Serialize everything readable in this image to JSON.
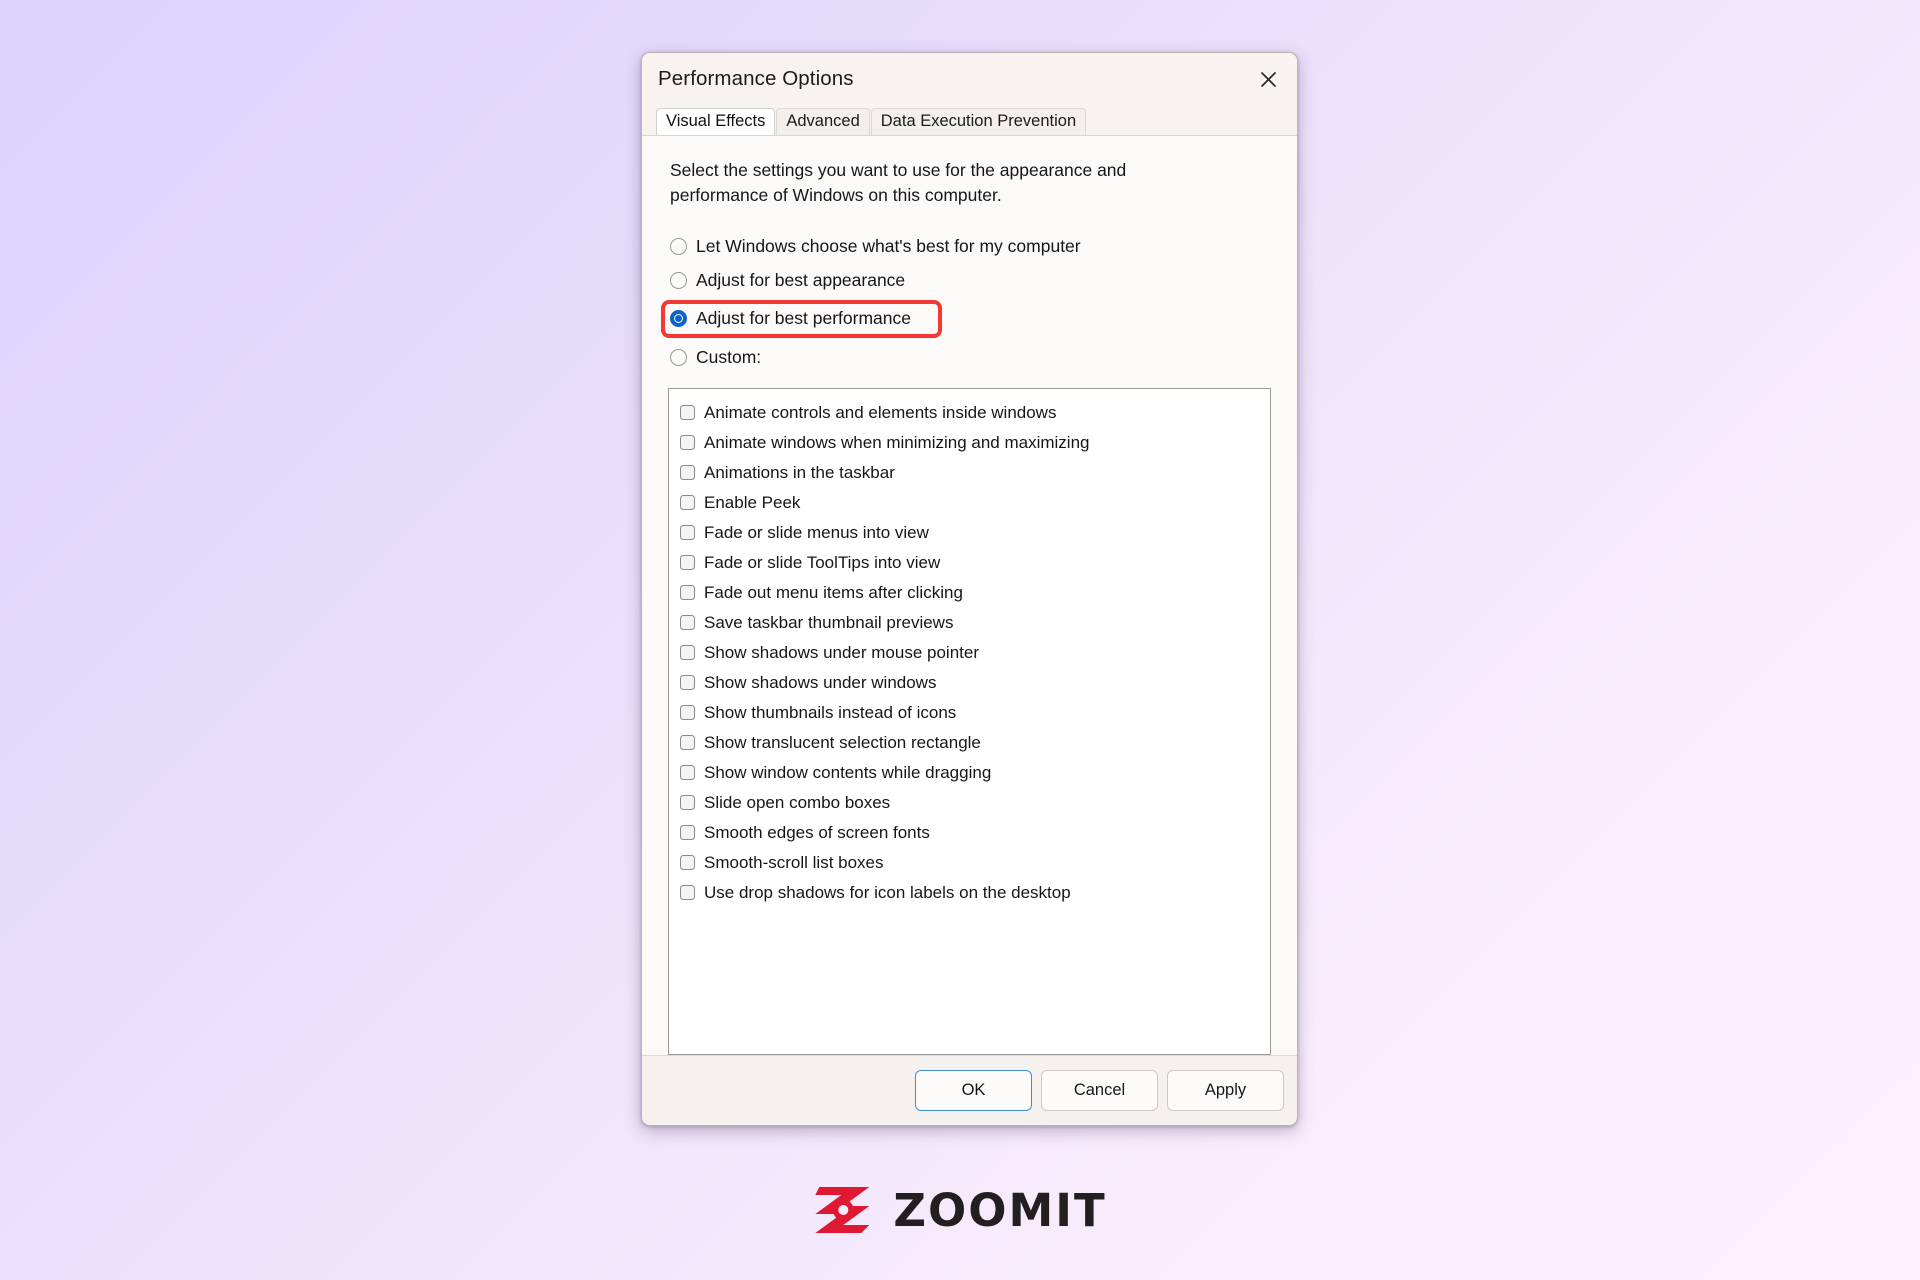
{
  "window": {
    "title": "Performance Options",
    "close_icon": "close-icon"
  },
  "tabs": [
    {
      "label": "Visual Effects",
      "active": true
    },
    {
      "label": "Advanced",
      "active": false
    },
    {
      "label": "Data Execution Prevention",
      "active": false
    }
  ],
  "panel": {
    "description": "Select the settings you want to use for the appearance and performance of Windows on this computer."
  },
  "radio_options": [
    {
      "label": "Let Windows choose what's best for my computer",
      "selected": false,
      "highlighted": false
    },
    {
      "label": "Adjust for best appearance",
      "selected": false,
      "highlighted": false
    },
    {
      "label": "Adjust for best performance",
      "selected": true,
      "highlighted": true
    },
    {
      "label": "Custom:",
      "selected": false,
      "highlighted": false
    }
  ],
  "effects": [
    {
      "label": "Animate controls and elements inside windows",
      "checked": false
    },
    {
      "label": "Animate windows when minimizing and maximizing",
      "checked": false
    },
    {
      "label": "Animations in the taskbar",
      "checked": false
    },
    {
      "label": "Enable Peek",
      "checked": false
    },
    {
      "label": "Fade or slide menus into view",
      "checked": false
    },
    {
      "label": "Fade or slide ToolTips into view",
      "checked": false
    },
    {
      "label": "Fade out menu items after clicking",
      "checked": false
    },
    {
      "label": "Save taskbar thumbnail previews",
      "checked": false
    },
    {
      "label": "Show shadows under mouse pointer",
      "checked": false
    },
    {
      "label": "Show shadows under windows",
      "checked": false
    },
    {
      "label": "Show thumbnails instead of icons",
      "checked": false
    },
    {
      "label": "Show translucent selection rectangle",
      "checked": false
    },
    {
      "label": "Show window contents while dragging",
      "checked": false
    },
    {
      "label": "Slide open combo boxes",
      "checked": false
    },
    {
      "label": "Smooth edges of screen fonts",
      "checked": false
    },
    {
      "label": "Smooth-scroll list boxes",
      "checked": false
    },
    {
      "label": "Use drop shadows for icon labels on the desktop",
      "checked": false
    }
  ],
  "footer": {
    "ok_label": "OK",
    "cancel_label": "Cancel",
    "apply_label": "Apply"
  },
  "watermark": {
    "text": "ZOOMIT",
    "mark_icon": "zoomit-z-icon"
  },
  "colors": {
    "highlight_red": "#f23a32",
    "radio_blue": "#0b63ce",
    "focus_blue": "#3f8fd8",
    "logo_red": "#e01933",
    "logo_dark": "#231f20",
    "background_start": "#dcd3fb",
    "background_end": "#fdeffe"
  }
}
